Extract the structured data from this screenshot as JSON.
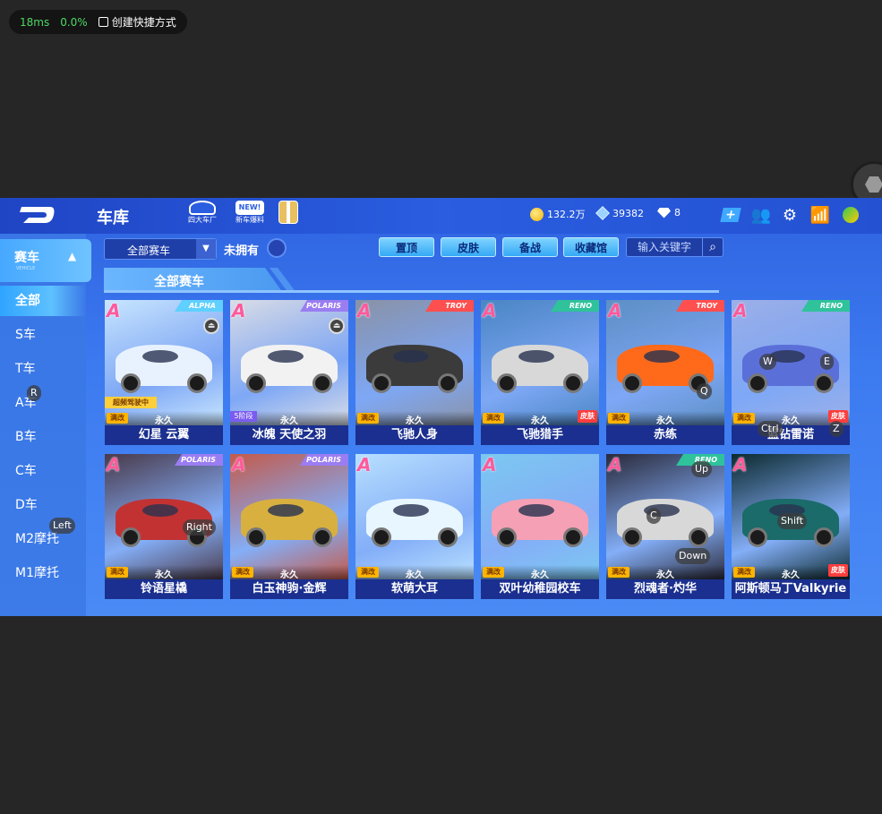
{
  "overlay": {
    "latency": "18ms",
    "loss": "0.0%",
    "shortcut_label": "创建快捷方式"
  },
  "topbar": {
    "title": "车库",
    "icons": [
      {
        "label": "四大车厂",
        "icon": "car-factory-icon"
      },
      {
        "label": "新车爆料",
        "icon": "new-car-icon"
      },
      {
        "label": "",
        "icon": "gift-icon"
      }
    ],
    "coins": "132.2万",
    "gems": "39382",
    "diamonds": "8",
    "right_icons": [
      "add-icon",
      "friends-icon",
      "gear-icon",
      "wifi-icon",
      "music-icon"
    ]
  },
  "sidebar": {
    "category": "赛车",
    "category_sub": "VEHICLE",
    "items": [
      "全部",
      "S车",
      "T车",
      "A车",
      "B车",
      "C车",
      "D车",
      "M2摩托",
      "M1摩托"
    ],
    "active_index": 0
  },
  "filters": {
    "dropdown_value": "全部赛车",
    "not_owned_label": "未拥有",
    "buttons": [
      "置顶",
      "皮肤",
      "备战",
      "收藏馆"
    ],
    "search_placeholder": "输入关键字"
  },
  "section_title": "全部赛车",
  "cars": [
    {
      "name": "幻星 云翼",
      "grade": "A",
      "brand": "ALPHA",
      "brand_color": "#5fd0ff",
      "bg": "#c8e6ff",
      "car": "#e8f2ff",
      "mangai": "满改",
      "perm": "永久",
      "skin": "",
      "banner": "超频驾驶中",
      "level": ""
    },
    {
      "name": "冰魄 天使之羽",
      "grade": "A",
      "brand": "POLARIS",
      "brand_color": "#9b7df2",
      "bg": "#d9dde6",
      "car": "#f2f2f2",
      "mangai": "",
      "perm": "永久",
      "skin": "",
      "banner": "",
      "level": "5阶段"
    },
    {
      "name": "飞驰人身",
      "grade": "A",
      "brand": "TROY",
      "brand_color": "#ff4f4f",
      "bg": "#8a93a6",
      "car": "#3b3b3b",
      "mangai": "满改",
      "perm": "永久",
      "skin": "",
      "banner": "",
      "level": ""
    },
    {
      "name": "飞驰猎手",
      "grade": "A",
      "brand": "RENO",
      "brand_color": "#2fc29b",
      "bg": "#4a86c4",
      "car": "#d8d8d8",
      "mangai": "满改",
      "perm": "永久",
      "skin": "皮肤",
      "banner": "",
      "level": ""
    },
    {
      "name": "赤练",
      "grade": "A",
      "brand": "TROY",
      "brand_color": "#ff4f4f",
      "bg": "#5d8fc4",
      "car": "#ff6a1a",
      "mangai": "满改",
      "perm": "永久",
      "skin": "",
      "banner": "",
      "level": ""
    },
    {
      "name": "蓝钻雷诺",
      "grade": "A",
      "brand": "RENO",
      "brand_color": "#2fc29b",
      "bg": "#9cb0e8",
      "car": "#5a6fd8",
      "mangai": "满改",
      "perm": "永久",
      "skin": "皮肤",
      "banner": "",
      "level": ""
    },
    {
      "name": "铃语星橇",
      "grade": "A",
      "brand": "POLARIS",
      "brand_color": "#9b7df2",
      "bg": "#4a3a4a",
      "car": "#c23232",
      "mangai": "满改",
      "perm": "永久",
      "skin": "",
      "banner": "",
      "level": ""
    },
    {
      "name": "白玉神驹·金辉",
      "grade": "A",
      "brand": "POLARIS",
      "brand_color": "#9b7df2",
      "bg": "#c45a4a",
      "car": "#d8b040",
      "mangai": "满改",
      "perm": "永久",
      "skin": "",
      "banner": "",
      "level": ""
    },
    {
      "name": "软萌大耳",
      "grade": "A",
      "brand": "",
      "brand_color": "#9b7df2",
      "bg": "#b8e0ff",
      "car": "#e8f6ff",
      "mangai": "满改",
      "perm": "永久",
      "skin": "",
      "banner": "",
      "level": ""
    },
    {
      "name": "双叶幼稚园校车",
      "grade": "A",
      "brand": "",
      "brand_color": "#9b7df2",
      "bg": "#7cc8f0",
      "car": "#f5a0b4",
      "mangai": "满改",
      "perm": "永久",
      "skin": "",
      "banner": "",
      "level": ""
    },
    {
      "name": "烈魂者·灼华",
      "grade": "A",
      "brand": "RENO",
      "brand_color": "#2fc29b",
      "bg": "#2a2a3a",
      "car": "#d8d8d8",
      "mangai": "满改",
      "perm": "永久",
      "skin": "",
      "banner": "",
      "level": ""
    },
    {
      "name": "阿斯顿马丁Valkyrie",
      "grade": "A",
      "brand": "",
      "brand_color": "#9b7df2",
      "bg": "#0c2a2e",
      "car": "#1a6b6a",
      "mangai": "满改",
      "perm": "永久",
      "skin": "皮肤",
      "banner": "",
      "level": ""
    }
  ],
  "key_hints": [
    "R",
    "Left",
    "Right",
    "W",
    "E",
    "Q",
    "Ctrl",
    "Z",
    "Up",
    "C",
    "Down",
    "Shift"
  ],
  "colors": {
    "accent": "#2e62e0",
    "name_bar": "#1a2f8f",
    "skin_badge": "#ff3d3d"
  }
}
